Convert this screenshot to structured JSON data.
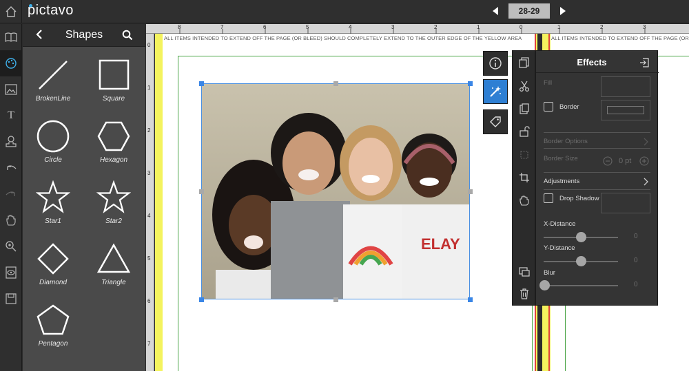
{
  "app": {
    "logo_text": "pictavo"
  },
  "page_nav": {
    "current": "28-29"
  },
  "shapes_panel": {
    "title": "Shapes",
    "items": [
      {
        "label": "BrokenLine",
        "icon": "broken-line"
      },
      {
        "label": "Square",
        "icon": "square"
      },
      {
        "label": "Circle",
        "icon": "circle"
      },
      {
        "label": "Hexagon",
        "icon": "hexagon"
      },
      {
        "label": "Star1",
        "icon": "star"
      },
      {
        "label": "Star2",
        "icon": "star"
      },
      {
        "label": "Diamond",
        "icon": "diamond"
      },
      {
        "label": "Triangle",
        "icon": "triangle"
      },
      {
        "label": "Pentagon",
        "icon": "pentagon"
      }
    ]
  },
  "rulers": {
    "top_numbers": [
      "8",
      "7",
      "6",
      "5",
      "4",
      "3",
      "2",
      "1",
      "0",
      "1",
      "2",
      "3"
    ],
    "left_numbers": [
      "0",
      "1",
      "2",
      "3",
      "4",
      "5",
      "6",
      "7"
    ]
  },
  "canvas": {
    "bleed_notice_left": "ALL ITEMS INTENDED TO EXTEND OFF THE PAGE (OR BLEED) SHOULD COMPLETELY EXTEND TO THE OUTER EDGE OF THE YELLOW AREA",
    "bleed_notice_right": "ALL ITEMS INTENDED TO EXTEND OFF THE PAGE (OR BLEED) SHOULD COMPLETELY EXTEND"
  },
  "effects": {
    "title": "Effects",
    "fill_label": "Fill",
    "border_label": "Border",
    "border_options_label": "Border Options",
    "border_size_label": "Border Size",
    "border_size_value": "0 pt",
    "adjustments_label": "Adjustments",
    "drop_shadow_label": "Drop Shadow",
    "x_distance_label": "X-Distance",
    "x_distance_value": "0",
    "y_distance_label": "Y-Distance",
    "y_distance_value": "0",
    "blur_label": "Blur",
    "blur_value": "0"
  },
  "colors": {
    "accent": "#2e7fd3",
    "bleed_yellow": "#f4f35e",
    "margin_green": "#4aa545",
    "trim_red": "#e0433a"
  }
}
